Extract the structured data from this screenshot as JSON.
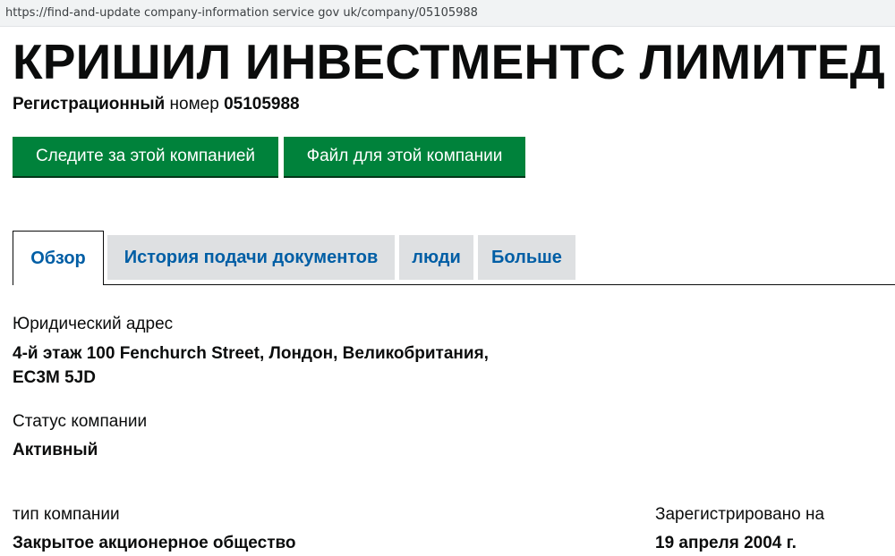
{
  "browser": {
    "url": "https://find-and-update company-information service gov uk/company/05105988"
  },
  "company": {
    "name": "КРИШИЛ ИНВЕСТМЕНТС ЛИМИТЕД",
    "registration": {
      "label_bold": "Регистрационный",
      "label_rest": " номер ",
      "number": "05105988"
    }
  },
  "actions": {
    "follow_label": "Следите за этой компанией",
    "file_label": "Файл для этой компании"
  },
  "tabs": [
    {
      "label": "Обзор",
      "active": true
    },
    {
      "label": "История подачи документов",
      "active": false
    },
    {
      "label": "люди",
      "active": false
    },
    {
      "label": "Больше",
      "active": false
    }
  ],
  "overview": {
    "registered_office": {
      "label": "Юридический адрес",
      "line1": "4-й этаж 100 Fenchurch Street, Лондон, Великобритания,",
      "line2": "EC3M 5JD"
    },
    "status": {
      "label": "Статус компании",
      "value": "Активный"
    },
    "type": {
      "label": "тип компании",
      "value": "Закрытое акционерное общество"
    },
    "incorporated": {
      "label": "Зарегистрировано на",
      "value": "19 апреля 2004 г."
    }
  },
  "colors": {
    "button_green": "#00823b",
    "link_blue": "#005ea5",
    "tab_grey": "#dee0e2",
    "text": "#0b0c0c"
  }
}
